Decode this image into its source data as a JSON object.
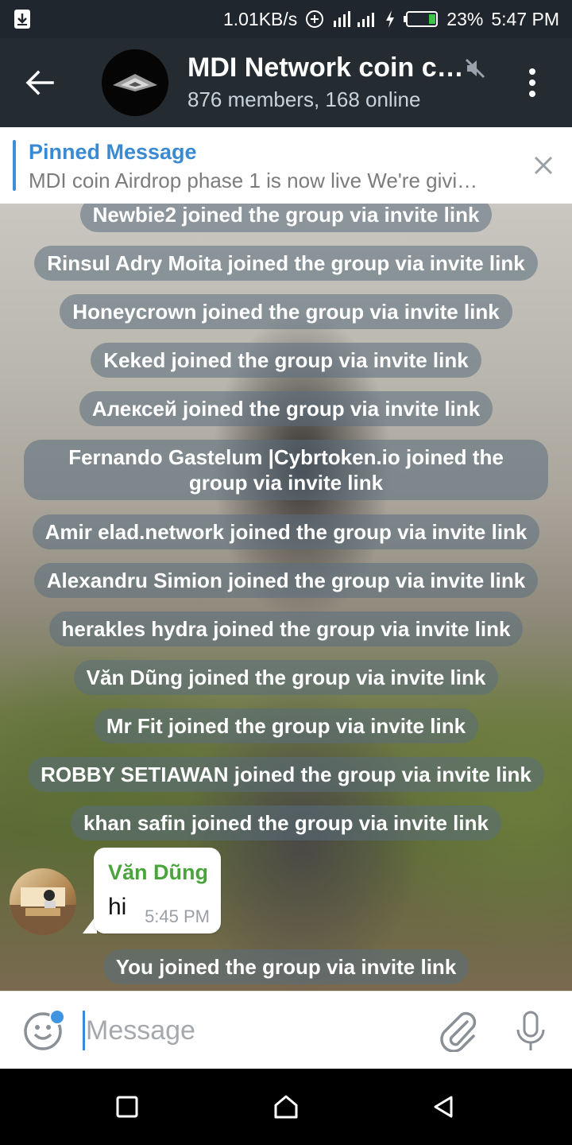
{
  "status_bar": {
    "speed": "1.01KB/s",
    "battery": "23%",
    "time": "5:47 PM"
  },
  "header": {
    "title": "MDI Network coin c…",
    "subtitle": "876 members, 168 online"
  },
  "pinned": {
    "title": "Pinned Message",
    "text": "MDI coin Airdrop phase 1 is now live We're givi…"
  },
  "messages": {
    "service": [
      "Newbie2 joined the group via invite link",
      "Rinsul Adry Moita joined the group via invite link",
      "Honeycrown joined the group via invite link",
      "Keked joined the group via invite link",
      "Алексей joined the group via invite link",
      "Fernando Gastelum |Cybrtoken.io joined the group via invite link",
      "Amir elad.network joined the group via invite link",
      "Alexandru Simion joined the group via invite link",
      "herakles hydra joined the group via invite link",
      "Văn Dũng joined the group via invite link",
      "Mr Fit joined the group via invite link",
      "ROBBY SETIAWAN joined the group via invite link",
      "khan safin joined the group via invite link",
      "You joined the group via invite link"
    ],
    "chat_message": {
      "sender": "Văn Dũng",
      "text": "hi",
      "time": "5:45 PM"
    }
  },
  "input": {
    "placeholder": "Message"
  },
  "colors": {
    "header_bg": "#242b31",
    "accent": "#3a8ad3",
    "sender_name": "#4aa43c"
  }
}
